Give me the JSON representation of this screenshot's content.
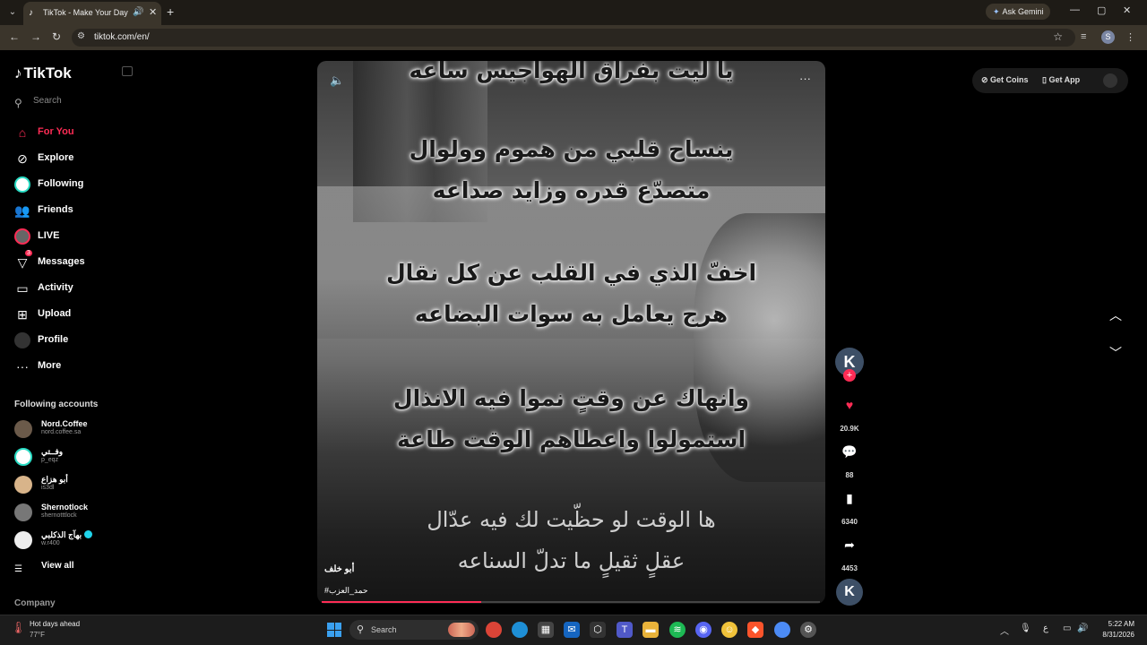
{
  "browser": {
    "tab_title": "TikTok - Make Your Day",
    "url": "tiktok.com/en/",
    "gemini_label": "Ask Gemini",
    "profile_initial": "S"
  },
  "sidebar": {
    "logo": "TikTok",
    "search_placeholder": "Search",
    "nav": [
      {
        "label": "For You",
        "icon": "home-icon",
        "active": true
      },
      {
        "label": "Explore",
        "icon": "compass-icon"
      },
      {
        "label": "Following",
        "icon": "following-avatar-icon"
      },
      {
        "label": "Friends",
        "icon": "friends-icon"
      },
      {
        "label": "LIVE",
        "icon": "live-icon"
      },
      {
        "label": "Messages",
        "icon": "messages-icon",
        "badge": "3"
      },
      {
        "label": "Activity",
        "icon": "activity-icon"
      },
      {
        "label": "Upload",
        "icon": "upload-icon"
      },
      {
        "label": "Profile",
        "icon": "profile-icon"
      },
      {
        "label": "More",
        "icon": "more-icon"
      }
    ],
    "following_title": "Following accounts",
    "accounts": [
      {
        "name": "Nord.Coffee",
        "handle": "nord.coffee.sa"
      },
      {
        "name": "وفــتي",
        "handle": "p_eqz"
      },
      {
        "name": "أبو هزاع",
        "handle": "is3dl"
      },
      {
        "name": "Shernotlock",
        "handle": "shernotttlock"
      },
      {
        "name": "بهآج الذكلبي",
        "handle": "w.r400",
        "verified": true
      }
    ],
    "view_all": "View all",
    "company": "Company"
  },
  "video": {
    "poem_lines": [
      "يا ليت بفراق الهواجيس ساعه",
      "ينساح قلبي من هموم وولوال",
      "متصدّع قدره وزايد صداعه",
      "اخفّ الذي في القلب عن كل نقال",
      "هرج يعامل به سوات البضاعه",
      "وانهاك عن وقتٍ نموا فيه الانذال",
      "استمولوا واعطاهم الوقت طاعة",
      "ها الوقت لو حظّيت لك فيه عدّال",
      "عقلٍ ثقيلٍ ما تدلّ السناعه"
    ],
    "author": "أبو خلف",
    "hashtag": "#حمد_العزب",
    "progress": 0.32
  },
  "actions": {
    "creator_initial": "K",
    "likes": "20.9K",
    "comments": "88",
    "saves": "6340",
    "shares": "4453"
  },
  "topbar": {
    "get_coins": "Get Coins",
    "get_app": "Get App"
  },
  "taskbar": {
    "weather_title": "Hot days ahead",
    "weather_temp": "77°F",
    "search": "Search",
    "lang": "ع",
    "time": "5:22 AM",
    "date": "8/31/2026"
  }
}
